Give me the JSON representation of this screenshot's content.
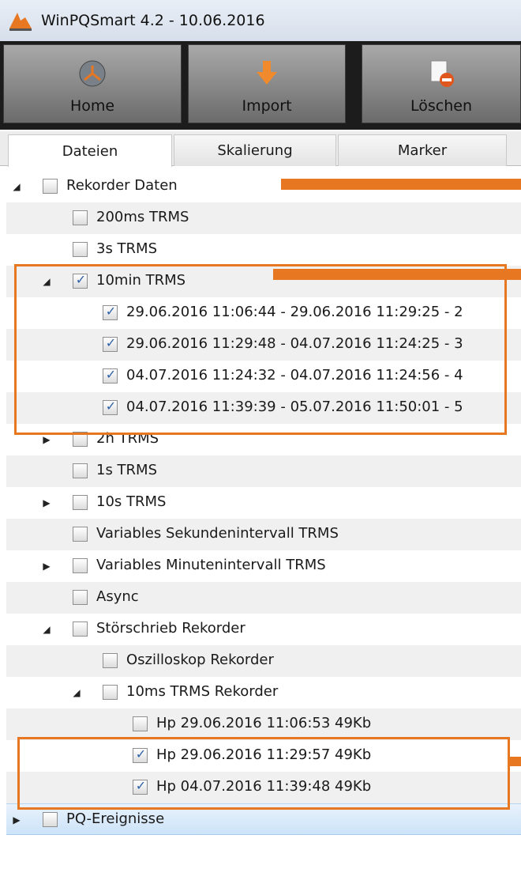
{
  "window": {
    "title": "WinPQSmart  4.2 - 10.06.2016"
  },
  "toolbar": {
    "home": "Home",
    "import": "Import",
    "delete": "Löschen"
  },
  "tabs": [
    "Dateien",
    "Skalierung",
    "Marker"
  ],
  "tree": [
    {
      "label": "Rekorder Daten",
      "level": 0,
      "expander": "expanded",
      "checked": false
    },
    {
      "label": "200ms TRMS",
      "level": 1,
      "expander": "none",
      "checked": false
    },
    {
      "label": "3s TRMS",
      "level": 1,
      "expander": "none",
      "checked": false
    },
    {
      "label": "10min TRMS",
      "level": 1,
      "expander": "expanded",
      "checked": true
    },
    {
      "label": "29.06.2016 11:06:44 - 29.06.2016 11:29:25 - 2",
      "level": 2,
      "expander": "none",
      "checked": true
    },
    {
      "label": "29.06.2016 11:29:48 - 04.07.2016 11:24:25 - 3",
      "level": 2,
      "expander": "none",
      "checked": true
    },
    {
      "label": "04.07.2016 11:24:32 - 04.07.2016 11:24:56 - 4",
      "level": 2,
      "expander": "none",
      "checked": true
    },
    {
      "label": "04.07.2016 11:39:39 - 05.07.2016 11:50:01 - 5",
      "level": 2,
      "expander": "none",
      "checked": true
    },
    {
      "label": "2h TRMS",
      "level": 1,
      "expander": "collapsed",
      "checked": false
    },
    {
      "label": "1s TRMS",
      "level": 1,
      "expander": "none",
      "checked": false
    },
    {
      "label": "10s TRMS",
      "level": 1,
      "expander": "collapsed",
      "checked": false
    },
    {
      "label": "Variables Sekundenintervall TRMS",
      "level": 1,
      "expander": "none",
      "checked": false
    },
    {
      "label": "Variables Minutenintervall TRMS",
      "level": 1,
      "expander": "collapsed",
      "checked": false
    },
    {
      "label": "Async",
      "level": 1,
      "expander": "none",
      "checked": false
    },
    {
      "label": "Störschrieb Rekorder",
      "level": 1,
      "expander": "expanded",
      "checked": false
    },
    {
      "label": "Oszilloskop Rekorder",
      "level": 2,
      "expander": "none",
      "checked": false
    },
    {
      "label": "10ms TRMS Rekorder",
      "level": 2,
      "expander": "expanded",
      "checked": false
    },
    {
      "label": "Hp 29.06.2016 11:06:53 49Kb",
      "level": 3,
      "expander": "none",
      "checked": false
    },
    {
      "label": "Hp 29.06.2016 11:29:57 49Kb",
      "level": 3,
      "expander": "none",
      "checked": true
    },
    {
      "label": "Hp 04.07.2016 11:39:48 49Kb",
      "level": 3,
      "expander": "none",
      "checked": true
    },
    {
      "label": "PQ-Ereignisse",
      "level": 0,
      "expander": "collapsed",
      "checked": false,
      "selected": true
    }
  ],
  "colors": {
    "annotation": "#e87722",
    "checkmark": "#2c5fa8",
    "selection": "#cde3f8"
  }
}
